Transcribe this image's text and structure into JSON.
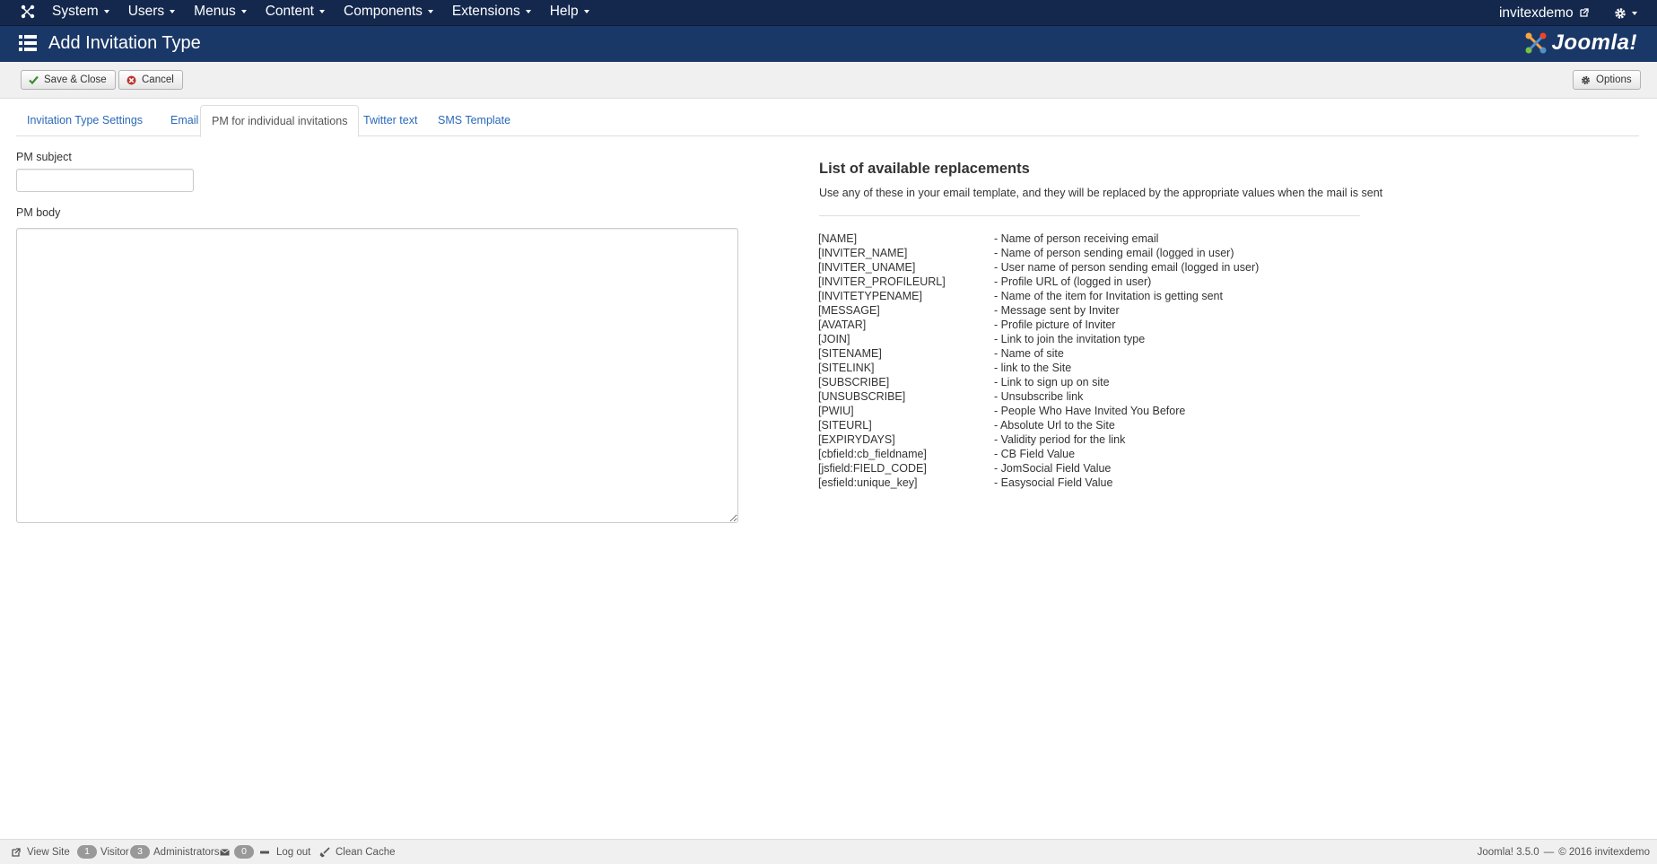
{
  "navbar": {
    "menu": [
      {
        "label": "System"
      },
      {
        "label": "Users"
      },
      {
        "label": "Menus"
      },
      {
        "label": "Content"
      },
      {
        "label": "Components"
      },
      {
        "label": "Extensions"
      },
      {
        "label": "Help"
      }
    ],
    "user": "invitexdemo"
  },
  "header": {
    "title": "Add Invitation Type",
    "brand": "Joomla!"
  },
  "toolbar": {
    "save_close_label": "Save & Close",
    "cancel_label": "Cancel",
    "options_label": "Options"
  },
  "tabs": [
    {
      "label": "Invitation Type Settings",
      "active": false
    },
    {
      "label": "Email",
      "active": false
    },
    {
      "label": "PM for individual invitations",
      "active": true
    },
    {
      "label": "Twitter text",
      "active": false
    },
    {
      "label": "SMS Template",
      "active": false
    }
  ],
  "form": {
    "pm_subject_label": "PM subject",
    "pm_subject_value": "",
    "pm_body_label": "PM body",
    "pm_body_value": ""
  },
  "replacements": {
    "title": "List of available replacements",
    "description": "Use any of these in your email template, and they will be replaced by the appropriate values when the mail is sent",
    "items": [
      {
        "key": "[NAME]",
        "desc": "- Name of person receiving email"
      },
      {
        "key": "[INVITER_NAME]",
        "desc": "- Name of person sending email (logged in user)"
      },
      {
        "key": "[INVITER_UNAME]",
        "desc": "- User name of person sending email (logged in user)"
      },
      {
        "key": "[INVITER_PROFILEURL]",
        "desc": "- Profile URL of (logged in user)"
      },
      {
        "key": "[INVITETYPENAME]",
        "desc": "- Name of the item for Invitation is getting sent"
      },
      {
        "key": "[MESSAGE]",
        "desc": "- Message sent by Inviter"
      },
      {
        "key": "[AVATAR]",
        "desc": "- Profile picture of Inviter"
      },
      {
        "key": "[JOIN]",
        "desc": "- Link to join the invitation type"
      },
      {
        "key": "[SITENAME]",
        "desc": "- Name of site"
      },
      {
        "key": "[SITELINK]",
        "desc": "- link to the Site"
      },
      {
        "key": "[SUBSCRIBE]",
        "desc": "- Link to sign up on site"
      },
      {
        "key": "[UNSUBSCRIBE]",
        "desc": "- Unsubscribe link"
      },
      {
        "key": "[PWIU]",
        "desc": "- People Who Have Invited You Before"
      },
      {
        "key": "[SITEURL]",
        "desc": "- Absolute Url to the Site"
      },
      {
        "key": "[EXPIRYDAYS]",
        "desc": "- Validity period for the link"
      },
      {
        "key": "[cbfield:cb_fieldname]",
        "desc": "- CB Field Value"
      },
      {
        "key": "[jsfield:FIELD_CODE]",
        "desc": "- JomSocial Field Value"
      },
      {
        "key": "[esfield:unique_key]",
        "desc": "- Easysocial Field Value"
      }
    ]
  },
  "statusbar": {
    "view_site": "View Site",
    "visitor_count": "1",
    "visitor_label": "Visitor",
    "admin_count": "3",
    "admin_label": "Administrators",
    "messages_count": "0",
    "logout_label": "Log out",
    "clean_cache_label": "Clean Cache",
    "version": "Joomla! 3.5.0",
    "separator": "—",
    "copyright": "© 2016 invitexdemo"
  },
  "colors": {
    "navbar_bg": "#14284d",
    "header_bg": "#1a3867",
    "link": "#2a69b8",
    "save_check": "#3c8d2f",
    "cancel_x": "#bd362f"
  }
}
